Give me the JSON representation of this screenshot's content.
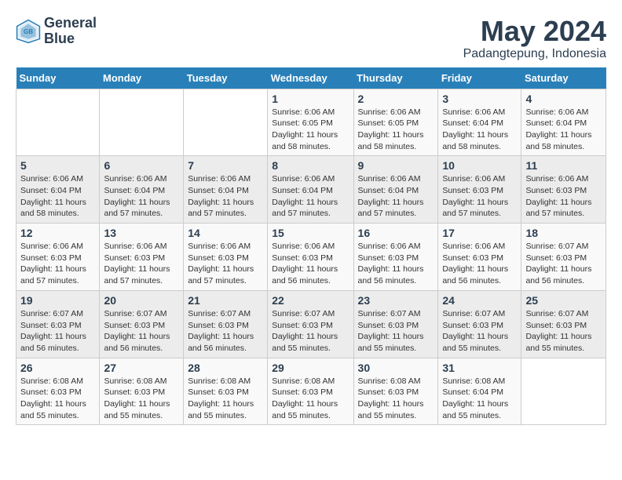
{
  "logo": {
    "line1": "General",
    "line2": "Blue"
  },
  "title": "May 2024",
  "location": "Padangtepung, Indonesia",
  "days_header": [
    "Sunday",
    "Monday",
    "Tuesday",
    "Wednesday",
    "Thursday",
    "Friday",
    "Saturday"
  ],
  "weeks": [
    [
      {
        "day": "",
        "info": ""
      },
      {
        "day": "",
        "info": ""
      },
      {
        "day": "",
        "info": ""
      },
      {
        "day": "1",
        "info": "Sunrise: 6:06 AM\nSunset: 6:05 PM\nDaylight: 11 hours\nand 58 minutes."
      },
      {
        "day": "2",
        "info": "Sunrise: 6:06 AM\nSunset: 6:05 PM\nDaylight: 11 hours\nand 58 minutes."
      },
      {
        "day": "3",
        "info": "Sunrise: 6:06 AM\nSunset: 6:04 PM\nDaylight: 11 hours\nand 58 minutes."
      },
      {
        "day": "4",
        "info": "Sunrise: 6:06 AM\nSunset: 6:04 PM\nDaylight: 11 hours\nand 58 minutes."
      }
    ],
    [
      {
        "day": "5",
        "info": "Sunrise: 6:06 AM\nSunset: 6:04 PM\nDaylight: 11 hours\nand 58 minutes."
      },
      {
        "day": "6",
        "info": "Sunrise: 6:06 AM\nSunset: 6:04 PM\nDaylight: 11 hours\nand 57 minutes."
      },
      {
        "day": "7",
        "info": "Sunrise: 6:06 AM\nSunset: 6:04 PM\nDaylight: 11 hours\nand 57 minutes."
      },
      {
        "day": "8",
        "info": "Sunrise: 6:06 AM\nSunset: 6:04 PM\nDaylight: 11 hours\nand 57 minutes."
      },
      {
        "day": "9",
        "info": "Sunrise: 6:06 AM\nSunset: 6:04 PM\nDaylight: 11 hours\nand 57 minutes."
      },
      {
        "day": "10",
        "info": "Sunrise: 6:06 AM\nSunset: 6:03 PM\nDaylight: 11 hours\nand 57 minutes."
      },
      {
        "day": "11",
        "info": "Sunrise: 6:06 AM\nSunset: 6:03 PM\nDaylight: 11 hours\nand 57 minutes."
      }
    ],
    [
      {
        "day": "12",
        "info": "Sunrise: 6:06 AM\nSunset: 6:03 PM\nDaylight: 11 hours\nand 57 minutes."
      },
      {
        "day": "13",
        "info": "Sunrise: 6:06 AM\nSunset: 6:03 PM\nDaylight: 11 hours\nand 57 minutes."
      },
      {
        "day": "14",
        "info": "Sunrise: 6:06 AM\nSunset: 6:03 PM\nDaylight: 11 hours\nand 57 minutes."
      },
      {
        "day": "15",
        "info": "Sunrise: 6:06 AM\nSunset: 6:03 PM\nDaylight: 11 hours\nand 56 minutes."
      },
      {
        "day": "16",
        "info": "Sunrise: 6:06 AM\nSunset: 6:03 PM\nDaylight: 11 hours\nand 56 minutes."
      },
      {
        "day": "17",
        "info": "Sunrise: 6:06 AM\nSunset: 6:03 PM\nDaylight: 11 hours\nand 56 minutes."
      },
      {
        "day": "18",
        "info": "Sunrise: 6:07 AM\nSunset: 6:03 PM\nDaylight: 11 hours\nand 56 minutes."
      }
    ],
    [
      {
        "day": "19",
        "info": "Sunrise: 6:07 AM\nSunset: 6:03 PM\nDaylight: 11 hours\nand 56 minutes."
      },
      {
        "day": "20",
        "info": "Sunrise: 6:07 AM\nSunset: 6:03 PM\nDaylight: 11 hours\nand 56 minutes."
      },
      {
        "day": "21",
        "info": "Sunrise: 6:07 AM\nSunset: 6:03 PM\nDaylight: 11 hours\nand 56 minutes."
      },
      {
        "day": "22",
        "info": "Sunrise: 6:07 AM\nSunset: 6:03 PM\nDaylight: 11 hours\nand 55 minutes."
      },
      {
        "day": "23",
        "info": "Sunrise: 6:07 AM\nSunset: 6:03 PM\nDaylight: 11 hours\nand 55 minutes."
      },
      {
        "day": "24",
        "info": "Sunrise: 6:07 AM\nSunset: 6:03 PM\nDaylight: 11 hours\nand 55 minutes."
      },
      {
        "day": "25",
        "info": "Sunrise: 6:07 AM\nSunset: 6:03 PM\nDaylight: 11 hours\nand 55 minutes."
      }
    ],
    [
      {
        "day": "26",
        "info": "Sunrise: 6:08 AM\nSunset: 6:03 PM\nDaylight: 11 hours\nand 55 minutes."
      },
      {
        "day": "27",
        "info": "Sunrise: 6:08 AM\nSunset: 6:03 PM\nDaylight: 11 hours\nand 55 minutes."
      },
      {
        "day": "28",
        "info": "Sunrise: 6:08 AM\nSunset: 6:03 PM\nDaylight: 11 hours\nand 55 minutes."
      },
      {
        "day": "29",
        "info": "Sunrise: 6:08 AM\nSunset: 6:03 PM\nDaylight: 11 hours\nand 55 minutes."
      },
      {
        "day": "30",
        "info": "Sunrise: 6:08 AM\nSunset: 6:03 PM\nDaylight: 11 hours\nand 55 minutes."
      },
      {
        "day": "31",
        "info": "Sunrise: 6:08 AM\nSunset: 6:04 PM\nDaylight: 11 hours\nand 55 minutes."
      },
      {
        "day": "",
        "info": ""
      }
    ]
  ]
}
